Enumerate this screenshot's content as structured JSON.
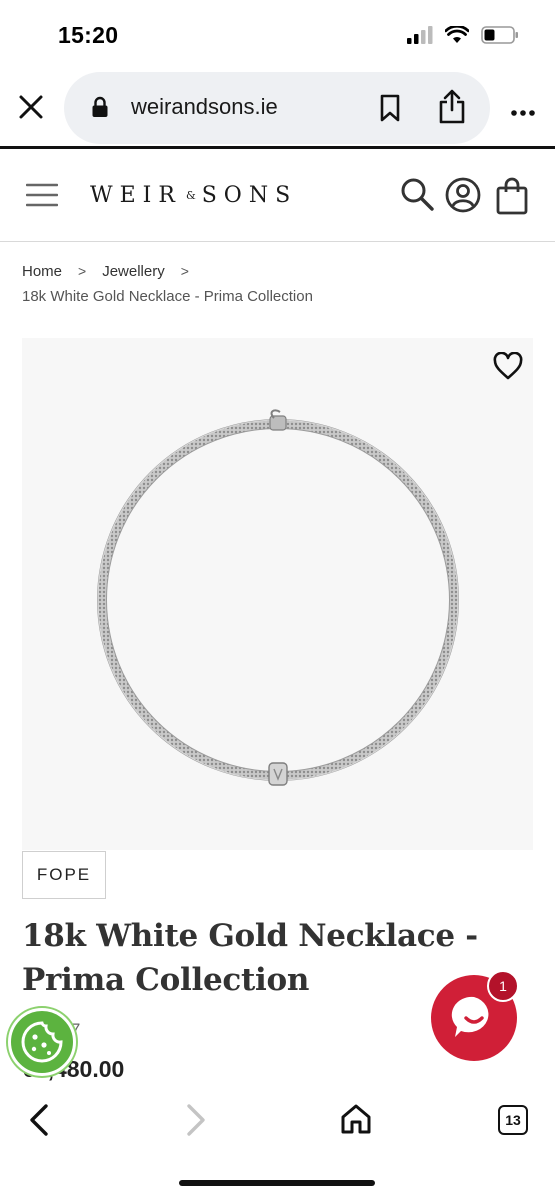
{
  "status_bar": {
    "time": "15:20",
    "battery_level": 0.3
  },
  "browser": {
    "url": "weirandsons.ie",
    "icons": {
      "close": "close-icon",
      "lock": "lock-icon",
      "bookmark": "bookmark-icon",
      "share": "share-icon",
      "more": "more-icon"
    }
  },
  "site": {
    "logo_left": "WEIR",
    "logo_amp": "&",
    "logo_right": "SONS",
    "icons": {
      "menu": "hamburger-menu-icon",
      "search": "search-icon",
      "account": "account-icon",
      "bag": "shopping-bag-icon"
    }
  },
  "breadcrumb": {
    "items": [
      "Home",
      "Jewellery"
    ],
    "separator": ">",
    "current": "18k White Gold Necklace - Prima Collection"
  },
  "product": {
    "brand": "FOPE",
    "title": "18k White Gold Necklace - Prima Collection",
    "sku": "257",
    "price": "€3,480.00",
    "price_visible": "5,480.00"
  },
  "chat": {
    "badge_count": "1",
    "accent": "#d01f37"
  },
  "cookie": {
    "color": "#5cb33f"
  },
  "toolbar": {
    "tab_count": "13"
  }
}
